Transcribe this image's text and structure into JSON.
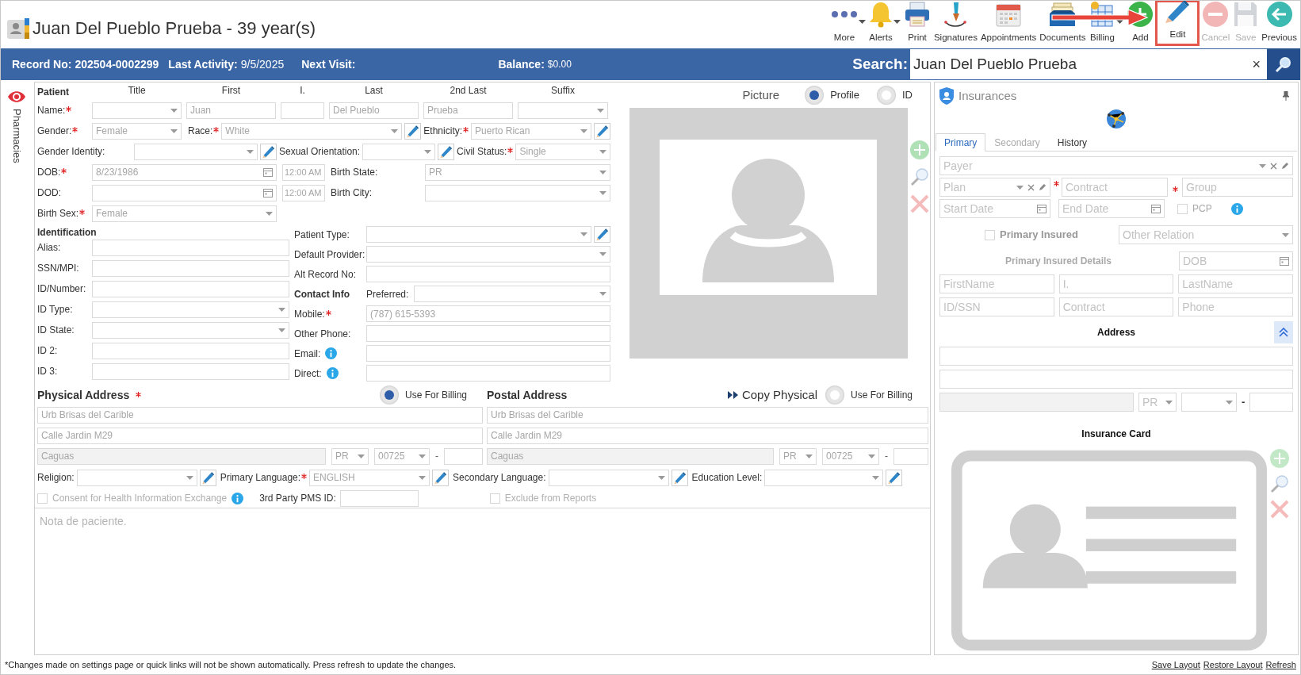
{
  "header": {
    "title": "Juan Del Pueblo Prueba - 39 year(s)"
  },
  "toolbar": [
    {
      "kind": "more",
      "label": "More",
      "dropdown": true,
      "disabled": false,
      "highlighted": false
    },
    {
      "kind": "alerts",
      "label": "Alerts",
      "dropdown": true,
      "disabled": false,
      "highlighted": false
    },
    {
      "kind": "print",
      "label": "Print",
      "dropdown": false,
      "disabled": false,
      "highlighted": false
    },
    {
      "kind": "signatures",
      "label": "Signatures",
      "dropdown": false,
      "disabled": false,
      "highlighted": false
    },
    {
      "kind": "appointments",
      "label": "Appointments",
      "dropdown": false,
      "disabled": false,
      "highlighted": false
    },
    {
      "kind": "documents",
      "label": "Documents",
      "dropdown": false,
      "disabled": false,
      "highlighted": false
    },
    {
      "kind": "billing",
      "label": "Billing",
      "dropdown": true,
      "disabled": false,
      "highlighted": false
    },
    {
      "kind": "add",
      "label": "Add",
      "dropdown": false,
      "disabled": false,
      "highlighted": false
    },
    {
      "kind": "edit",
      "label": "Edit",
      "dropdown": false,
      "disabled": false,
      "highlighted": true
    },
    {
      "kind": "cancel",
      "label": "Cancel",
      "dropdown": false,
      "disabled": true,
      "highlighted": false
    },
    {
      "kind": "save",
      "label": "Save",
      "dropdown": false,
      "disabled": true,
      "highlighted": false
    },
    {
      "kind": "previous",
      "label": "Previous",
      "dropdown": false,
      "disabled": false,
      "highlighted": false
    }
  ],
  "info_bar": {
    "record_label": "Record No:",
    "record": "202504-0002299",
    "last_activity_label": "Last Activity:",
    "last_activity": "9/5/2025",
    "next_visit_label": "Next Visit:",
    "balance_label": "Balance:",
    "balance": "$0.00",
    "search_label": "Search:",
    "search_value": "Juan Del Pueblo Prueba",
    "clear": "×"
  },
  "side_tab": {
    "label": "Pharmacies"
  },
  "patient": {
    "heading": "Patient",
    "columns": [
      "Title",
      "First",
      "I.",
      "Last",
      "2nd Last",
      "Suffix"
    ],
    "name": {
      "label": "Name:",
      "required": true,
      "fields": [
        {
          "kind": "select"
        },
        {
          "kind": "text",
          "value": "Juan"
        },
        {
          "kind": "text"
        },
        {
          "kind": "text",
          "value": "Del Pueblo"
        },
        {
          "kind": "text",
          "value": "Prueba"
        },
        {
          "kind": "select"
        }
      ]
    },
    "gender": {
      "label": "Gender:",
      "required": true,
      "kind": "select",
      "value": "Female"
    },
    "race": {
      "label": "Race:",
      "required": true,
      "kind": "select",
      "value": "White",
      "edit": true
    },
    "ethnicity": {
      "label": "Ethnicity:",
      "required": true,
      "kind": "select",
      "value": "Puerto Rican",
      "edit": true
    },
    "gender_identity": {
      "label": "Gender Identity:",
      "kind": "select",
      "edit": true
    },
    "sexual_orientation": {
      "label": "Sexual Orientation:",
      "kind": "select",
      "edit": true
    },
    "civil_status": {
      "label": "Civil Status:",
      "required": true,
      "kind": "select",
      "value": "Single"
    },
    "dob": {
      "label": "DOB:",
      "required": true,
      "kind": "date",
      "value": "8/23/1986",
      "time": "12:00 AM"
    },
    "birth_state": {
      "label": "Birth State:",
      "kind": "select",
      "value": "PR"
    },
    "dod": {
      "label": "DOD:",
      "kind": "date",
      "time": "12:00 AM"
    },
    "birth_city": {
      "label": "Birth City:",
      "kind": "select"
    },
    "birth_sex": {
      "label": "Birth Sex:",
      "required": true,
      "kind": "select",
      "value": "Female"
    }
  },
  "identification": {
    "heading": "Identification",
    "fields": [
      {
        "label": "Alias:",
        "kind": "text"
      },
      {
        "label": "SSN/MPI:",
        "kind": "text"
      },
      {
        "label": "ID/Number:",
        "kind": "text"
      },
      {
        "label": "ID Type:",
        "kind": "select"
      },
      {
        "label": "ID State:",
        "kind": "select"
      },
      {
        "label": "ID 2:",
        "kind": "text"
      },
      {
        "label": "ID 3:",
        "kind": "text"
      }
    ]
  },
  "other": {
    "fields": [
      {
        "label": "Patient Type:",
        "kind": "select",
        "edit": true
      },
      {
        "label": "Default Provider:",
        "kind": "select"
      },
      {
        "label": "Alt Record No:",
        "kind": "text"
      }
    ]
  },
  "contact": {
    "heading": "Contact Info",
    "preferred": {
      "label": "Preferred:",
      "kind": "select"
    },
    "fields": [
      {
        "label": "Mobile:",
        "required": true,
        "kind": "text",
        "value": "(787) 615-5393"
      },
      {
        "label": "Other Phone:",
        "kind": "text"
      },
      {
        "label": "Email:",
        "kind": "text",
        "info": true
      },
      {
        "label": "Direct:",
        "kind": "text",
        "info": true
      }
    ]
  },
  "picture": {
    "label": "Picture",
    "options": [
      {
        "label": "Profile",
        "selected": true
      },
      {
        "label": "ID",
        "selected": false
      }
    ]
  },
  "physical_address": {
    "heading": "Physical Address",
    "required": true,
    "use_for_billing": {
      "label": "Use For Billing",
      "selected": true
    },
    "line1": "Urb Brisas del Carible",
    "line2": "Calle Jardin M29",
    "city": "Caguas",
    "state": "PR",
    "zip": "00725",
    "zip_separator": "-"
  },
  "postal_address": {
    "heading": "Postal Address",
    "copy_button": "Copy Physical",
    "use_for_billing": {
      "label": "Use For Billing",
      "selected": false
    },
    "line1": "Urb Brisas del Carible",
    "line2": "Calle Jardin M29",
    "city": "Caguas",
    "state": "PR",
    "zip": "00725",
    "zip_separator": "-"
  },
  "extra": {
    "fields": [
      {
        "label": "Religion:",
        "kind": "select",
        "edit": true
      },
      {
        "label": "Primary Language:",
        "required": true,
        "kind": "select",
        "value": "ENGLISH",
        "edit": true
      },
      {
        "label": "Secondary Language:",
        "kind": "select",
        "edit": true
      },
      {
        "label": "Education Level:",
        "kind": "select",
        "edit": true
      }
    ]
  },
  "consent": {
    "label": "Consent for Health Information Exchange",
    "checked": false
  },
  "pms": {
    "label": "3rd Party PMS ID:"
  },
  "exclude": {
    "label": "Exclude from Reports",
    "checked": false
  },
  "notes": {
    "placeholder": "Nota de paciente."
  },
  "insurances": {
    "title": "Insurances",
    "tabs": [
      {
        "label": "Primary",
        "selected": true
      },
      {
        "label": "Secondary",
        "selected": false
      },
      {
        "label": "History",
        "selected": false
      }
    ],
    "payer": {
      "kind": "select",
      "placeholder": "Payer",
      "edit": true
    },
    "plan": {
      "kind": "select",
      "placeholder": "Plan",
      "edit": true
    },
    "contract": {
      "kind": "text",
      "placeholder": "Contract",
      "required": true
    },
    "group": {
      "kind": "text",
      "placeholder": "Group",
      "required": true
    },
    "start_date": {
      "kind": "date",
      "placeholder": "Start Date"
    },
    "end_date": {
      "kind": "date",
      "placeholder": "End Date"
    },
    "pcp": {
      "label": "PCP",
      "checked": false
    },
    "primary_insured": {
      "label": "Primary Insured",
      "checked": false
    },
    "relation": {
      "kind": "select",
      "placeholder": "Other Relation"
    },
    "details_heading": "Primary Insured Details",
    "dob": {
      "kind": "date",
      "placeholder": "DOB"
    },
    "person_fields": [
      {
        "kind": "text",
        "placeholder": "FirstName"
      },
      {
        "kind": "text",
        "placeholder": "I."
      },
      {
        "kind": "text",
        "placeholder": "LastName"
      },
      {
        "kind": "text",
        "placeholder": "ID/SSN"
      },
      {
        "kind": "text",
        "placeholder": "Contract"
      },
      {
        "kind": "text",
        "placeholder": "Phone"
      }
    ],
    "address_heading": "Address",
    "address_expanded": true,
    "state": "PR",
    "zip_separator": "-",
    "card_heading": "Insurance Card"
  },
  "footer": {
    "note": "*Changes made on settings page or quick links will not be shown automatically. Press refresh to update the changes.",
    "links": [
      "Save Layout",
      "Restore Layout",
      "Refresh"
    ]
  }
}
